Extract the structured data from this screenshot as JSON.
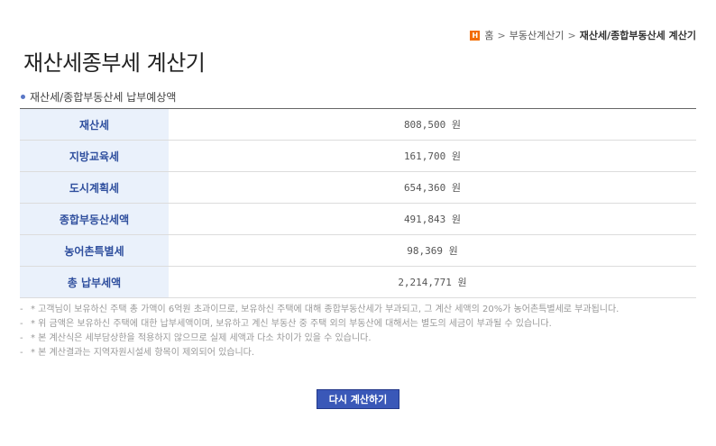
{
  "breadcrumb": {
    "home_icon": "H",
    "items": [
      "홈",
      "부동산계산기"
    ],
    "current": "재산세/종합부동산세 계산기",
    "separator": ">"
  },
  "page_title": "재산세종부세 계산기",
  "section_label": "재산세/종합부동산세 납부예상액",
  "rows": [
    {
      "label": "재산세",
      "value": "808,500 원"
    },
    {
      "label": "지방교육세",
      "value": "161,700 원"
    },
    {
      "label": "도시계획세",
      "value": "654,360 원"
    },
    {
      "label": "종합부동산세액",
      "value": "491,843 원"
    },
    {
      "label": "농어촌특별세",
      "value": "98,369 원"
    },
    {
      "label": "총 납부세액",
      "value": "2,214,771 원"
    }
  ],
  "notes": [
    "* 고객님이 보유하신 주택 총 가액이 6억원 초과이므로, 보유하신 주택에 대해 종합부동산세가 부과되고, 그 계산 세액의 20%가 농어촌특별세로 부과됩니다.",
    "* 위 금액은 보유하신 주택에 대한 납부세액이며, 보유하고 계신 부동산 중 주택 외의 부동산에 대해서는 별도의 세금이 부과될 수 있습니다.",
    "* 본 계산식은 세부담상한을 적용하지 않으므로 실제 세액과 다소 차이가 있을 수 있습니다.",
    "* 본 계산결과는 지역자원시설세 항목이 제외되어 있습니다."
  ],
  "note_prefix": "-",
  "recalc_button": "다시 계산하기",
  "colors": {
    "accent": "#3a58b8",
    "label_bg": "#eaf1fb",
    "label_text": "#2f4f9e",
    "home_icon": "#f26c00"
  }
}
